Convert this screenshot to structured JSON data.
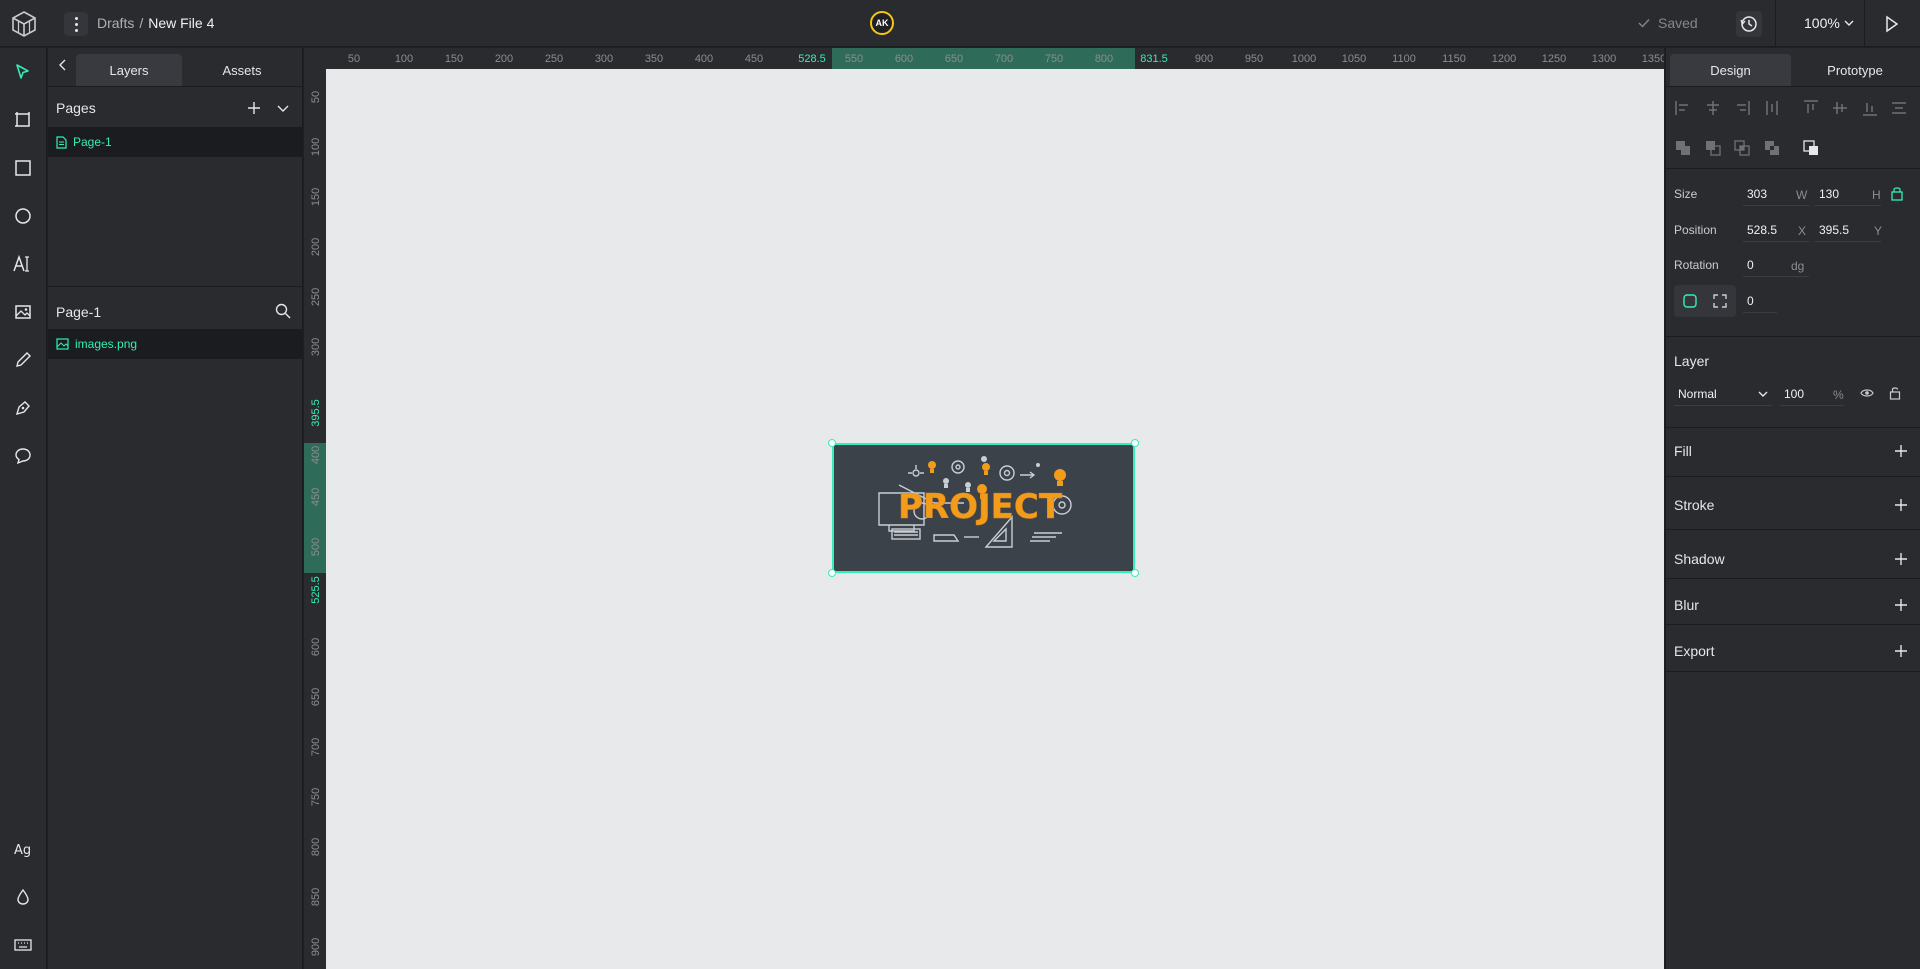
{
  "topbar": {
    "breadcrumb_root": "Drafts",
    "breadcrumb_sep": "/",
    "file_name": "New File 4",
    "avatar_initials": "AK",
    "avatar_ring_color": "#f5c518",
    "saved_label": "Saved",
    "zoom": "100%"
  },
  "left_panel": {
    "tab_layers": "Layers",
    "tab_assets": "Assets",
    "pages_title": "Pages",
    "pages": [
      {
        "label": "Page-1"
      }
    ],
    "current_page_title": "Page-1",
    "layers": [
      {
        "label": "images.png",
        "icon": "image-icon"
      }
    ]
  },
  "ruler": {
    "h_ticks": [
      "50",
      "100",
      "150",
      "200",
      "250",
      "300",
      "350",
      "400",
      "450",
      "528.5",
      "550",
      "600",
      "650",
      "700",
      "750",
      "800",
      "831.5",
      "900",
      "950",
      "1000",
      "1050",
      "1100",
      "1150",
      "1200",
      "1250",
      "1300",
      "1350"
    ],
    "v_ticks": [
      "50",
      "100",
      "150",
      "200",
      "250",
      "300",
      "395.5",
      "400",
      "450",
      "500",
      "525.5",
      "600",
      "650",
      "700",
      "750",
      "800",
      "850",
      "900"
    ]
  },
  "canvas": {
    "image_text": "PROJECT",
    "accent": "#31efb8"
  },
  "right_panel": {
    "tab_design": "Design",
    "tab_prototype": "Prototype",
    "size_label": "Size",
    "width": "303",
    "width_unit": "W",
    "height": "130",
    "height_unit": "H",
    "position_label": "Position",
    "pos_x": "528.5",
    "pos_x_unit": "X",
    "pos_y": "395.5",
    "pos_y_unit": "Y",
    "rotation_label": "Rotation",
    "rotation": "0",
    "rotation_unit": "dg",
    "radius": "0",
    "layer_label": "Layer",
    "blend_mode": "Normal",
    "opacity": "100",
    "opacity_unit": "%",
    "fill_label": "Fill",
    "stroke_label": "Stroke",
    "shadow_label": "Shadow",
    "blur_label": "Blur",
    "export_label": "Export"
  }
}
